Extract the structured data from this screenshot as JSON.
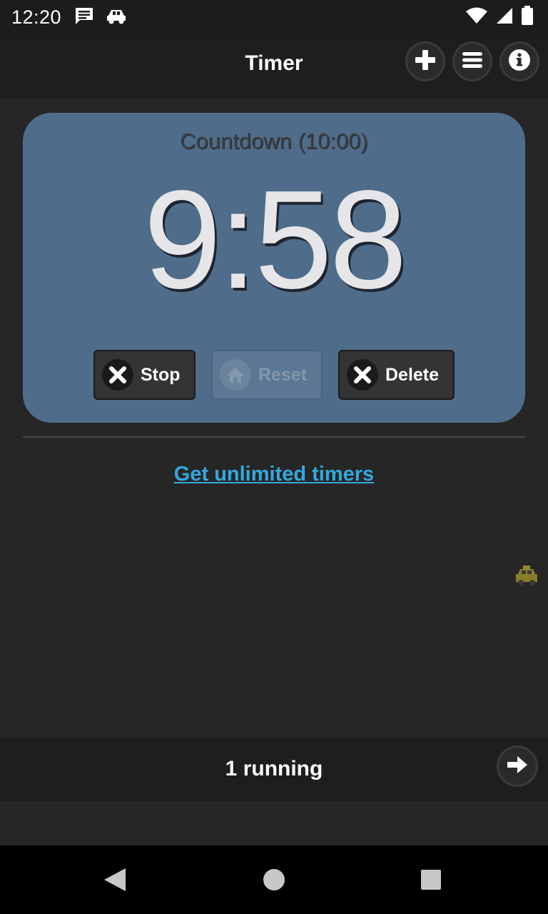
{
  "status_bar": {
    "time": "12:20",
    "icons": [
      "message-icon",
      "car-notification-icon",
      "wifi-icon",
      "signal-icon",
      "battery-icon"
    ]
  },
  "app_bar": {
    "title": "Timer",
    "actions": [
      "add-icon",
      "menu-icon",
      "info-icon"
    ]
  },
  "timer": {
    "label": "Countdown (10:00)",
    "value": "9:58",
    "card_color": "#4f6d8b",
    "buttons": {
      "stop": "Stop",
      "reset": "Reset",
      "delete": "Delete"
    }
  },
  "upgrade": {
    "link_text": "Get unlimited timers",
    "link_color": "#33a8de"
  },
  "running_bar": {
    "text": "1 running"
  },
  "nav_bar": {
    "buttons": [
      "back-icon",
      "home-icon",
      "recents-icon"
    ]
  }
}
